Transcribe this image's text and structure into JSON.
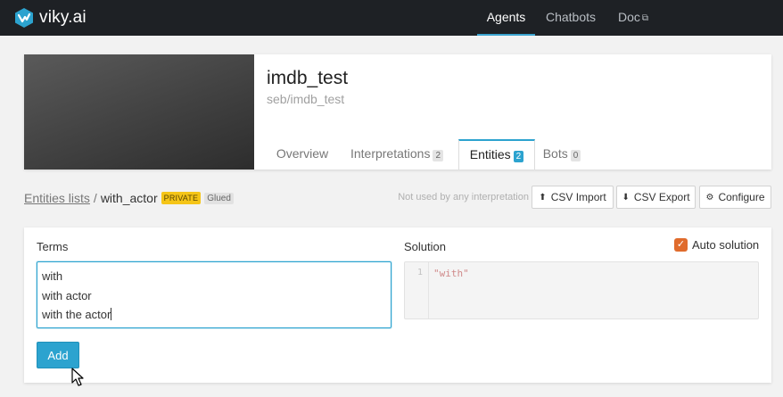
{
  "nav": {
    "brand": "viky.ai",
    "items": [
      {
        "label": "Agents",
        "active": true
      },
      {
        "label": "Chatbots",
        "active": false
      },
      {
        "label": "Doc",
        "active": false
      }
    ],
    "doc_icon": "external-link-icon"
  },
  "agent": {
    "name": "imdb_test",
    "slug": "seb/imdb_test",
    "tabs": {
      "overview": {
        "label": "Overview"
      },
      "interpretations": {
        "label": "Interpretations",
        "count": "2"
      },
      "entities": {
        "label": "Entities",
        "count": "2",
        "active": true
      },
      "bots": {
        "label": "Bots",
        "count": "0"
      }
    }
  },
  "breadcrumb": {
    "link": "Entities lists",
    "separator": "/",
    "current": "with_actor",
    "badge_private": "PRIVATE",
    "badge_glued": "Glued"
  },
  "actions": {
    "usage_note": "Not used by any interpretation",
    "csv_import": "CSV Import",
    "csv_export": "CSV Export",
    "configure": "Configure"
  },
  "form": {
    "terms_label": "Terms",
    "terms": [
      "with",
      "with actor",
      "with the actor"
    ],
    "solution_label": "Solution",
    "auto_solution_label": "Auto solution",
    "auto_solution_checked": true,
    "solution_line_number": "1",
    "solution_code": "\"with\"",
    "add_button": "Add"
  },
  "colors": {
    "accent": "#2ca3cf",
    "topbar": "#1e2125",
    "private_badge": "#f5c518",
    "checkbox": "#e06b2c"
  }
}
